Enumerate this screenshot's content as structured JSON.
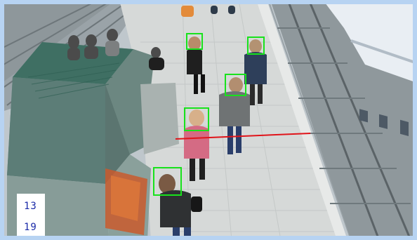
{
  "counters": {
    "top_value": "13",
    "bottom_value": "19"
  },
  "overlay": {
    "detection_color": "#18e21c",
    "count_line_color": "#e0141a",
    "counter_text_color": "#1a2aa8",
    "detections": [
      {
        "name": "person-detection-1"
      },
      {
        "name": "person-detection-2"
      },
      {
        "name": "person-detection-3"
      },
      {
        "name": "person-detection-4"
      },
      {
        "name": "person-detection-5"
      }
    ]
  }
}
